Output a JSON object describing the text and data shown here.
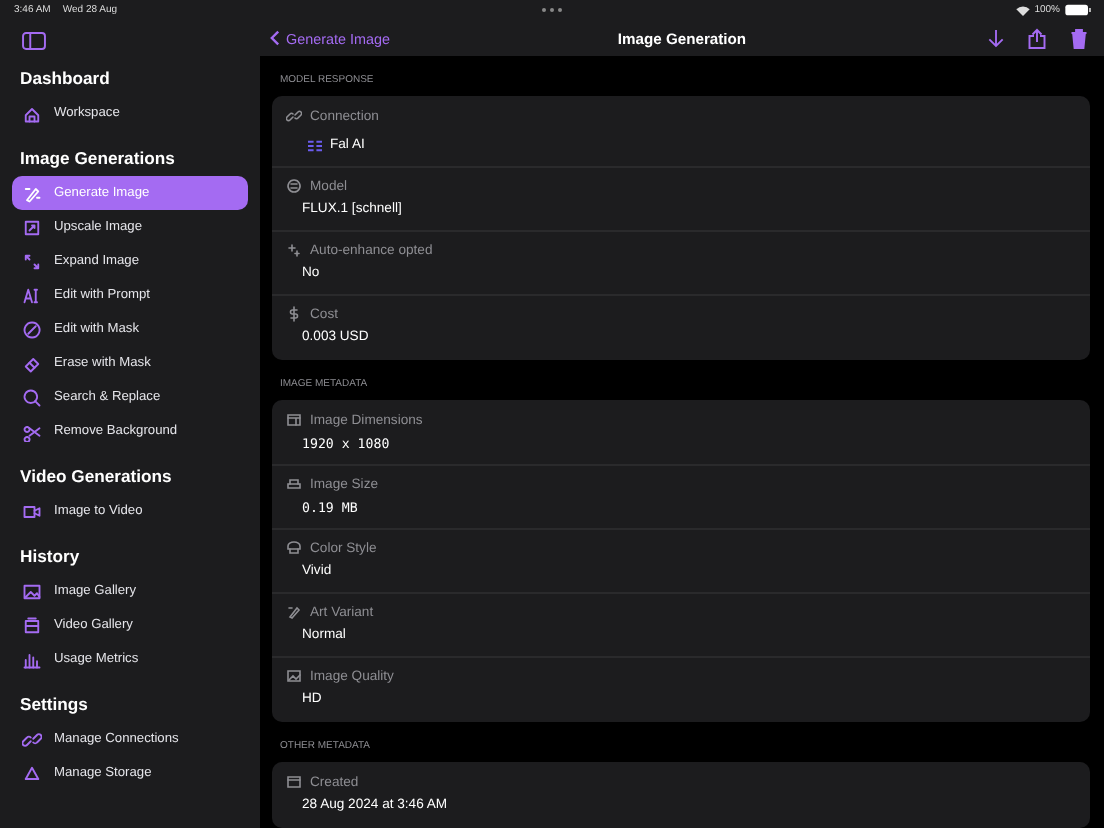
{
  "status_bar": {
    "time": "3:46 AM",
    "date": "Wed 28 Aug",
    "battery": "100%"
  },
  "sidebar": {
    "sections": [
      {
        "heading": "Dashboard",
        "items": [
          {
            "label": "Workspace",
            "selected": false
          }
        ]
      },
      {
        "heading": "Image Generations",
        "items": [
          {
            "label": "Generate Image",
            "selected": true
          },
          {
            "label": "Upscale Image",
            "selected": false
          },
          {
            "label": "Expand Image",
            "selected": false
          },
          {
            "label": "Edit with Prompt",
            "selected": false
          },
          {
            "label": "Edit with Mask",
            "selected": false
          },
          {
            "label": "Erase with Mask",
            "selected": false
          },
          {
            "label": "Search & Replace",
            "selected": false
          },
          {
            "label": "Remove Background",
            "selected": false
          }
        ]
      },
      {
        "heading": "Video Generations",
        "items": [
          {
            "label": "Image to Video",
            "selected": false
          }
        ]
      },
      {
        "heading": "History",
        "items": [
          {
            "label": "Image Gallery",
            "selected": false
          },
          {
            "label": "Video Gallery",
            "selected": false
          },
          {
            "label": "Usage Metrics",
            "selected": false
          }
        ]
      },
      {
        "heading": "Settings",
        "items": [
          {
            "label": "Manage Connections",
            "selected": false
          },
          {
            "label": "Manage Storage",
            "selected": false
          }
        ]
      }
    ]
  },
  "nav_bar": {
    "back": "Generate Image",
    "title": "Image Generation"
  },
  "sections": [
    {
      "header": "MODEL RESPONSE",
      "rows": [
        {
          "label": "Connection",
          "value": "Fal AI",
          "kind": "connection"
        },
        {
          "label": "Model",
          "value": "FLUX.1 [schnell]",
          "kind": "text"
        },
        {
          "label": "Auto-enhance opted",
          "value": "No",
          "kind": "text"
        },
        {
          "label": "Cost",
          "value": "0.003 USD",
          "kind": "text"
        }
      ]
    },
    {
      "header": "IMAGE METADATA",
      "rows": [
        {
          "label": "Image Dimensions",
          "value": "1920 x 1080",
          "kind": "mono"
        },
        {
          "label": "Image Size",
          "value": "0.19 MB",
          "kind": "mono"
        },
        {
          "label": "Color Style",
          "value": "Vivid",
          "kind": "text"
        },
        {
          "label": "Art Variant",
          "value": "Normal",
          "kind": "text"
        },
        {
          "label": "Image Quality",
          "value": "HD",
          "kind": "text"
        }
      ]
    },
    {
      "header": "OTHER METADATA",
      "rows": [
        {
          "label": "Created",
          "value": "28 Aug 2024 at 3:46 AM",
          "kind": "text"
        }
      ]
    }
  ]
}
